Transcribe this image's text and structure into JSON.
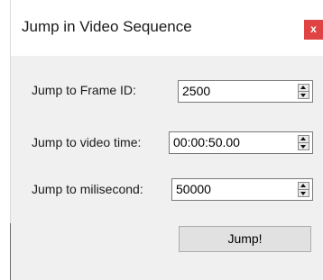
{
  "dialog": {
    "title": "Jump in Video Sequence",
    "close_glyph": "x",
    "close_color": "#e04343",
    "background": "#f0f0f0"
  },
  "fields": {
    "frame_id": {
      "label": "Jump to Frame ID:",
      "value": "2500"
    },
    "video_time": {
      "label": "Jump to video time:",
      "value": "00:00:50.00"
    },
    "millisecond": {
      "label": "Jump to milisecond:",
      "value": "50000"
    }
  },
  "actions": {
    "jump_label": "Jump!"
  }
}
